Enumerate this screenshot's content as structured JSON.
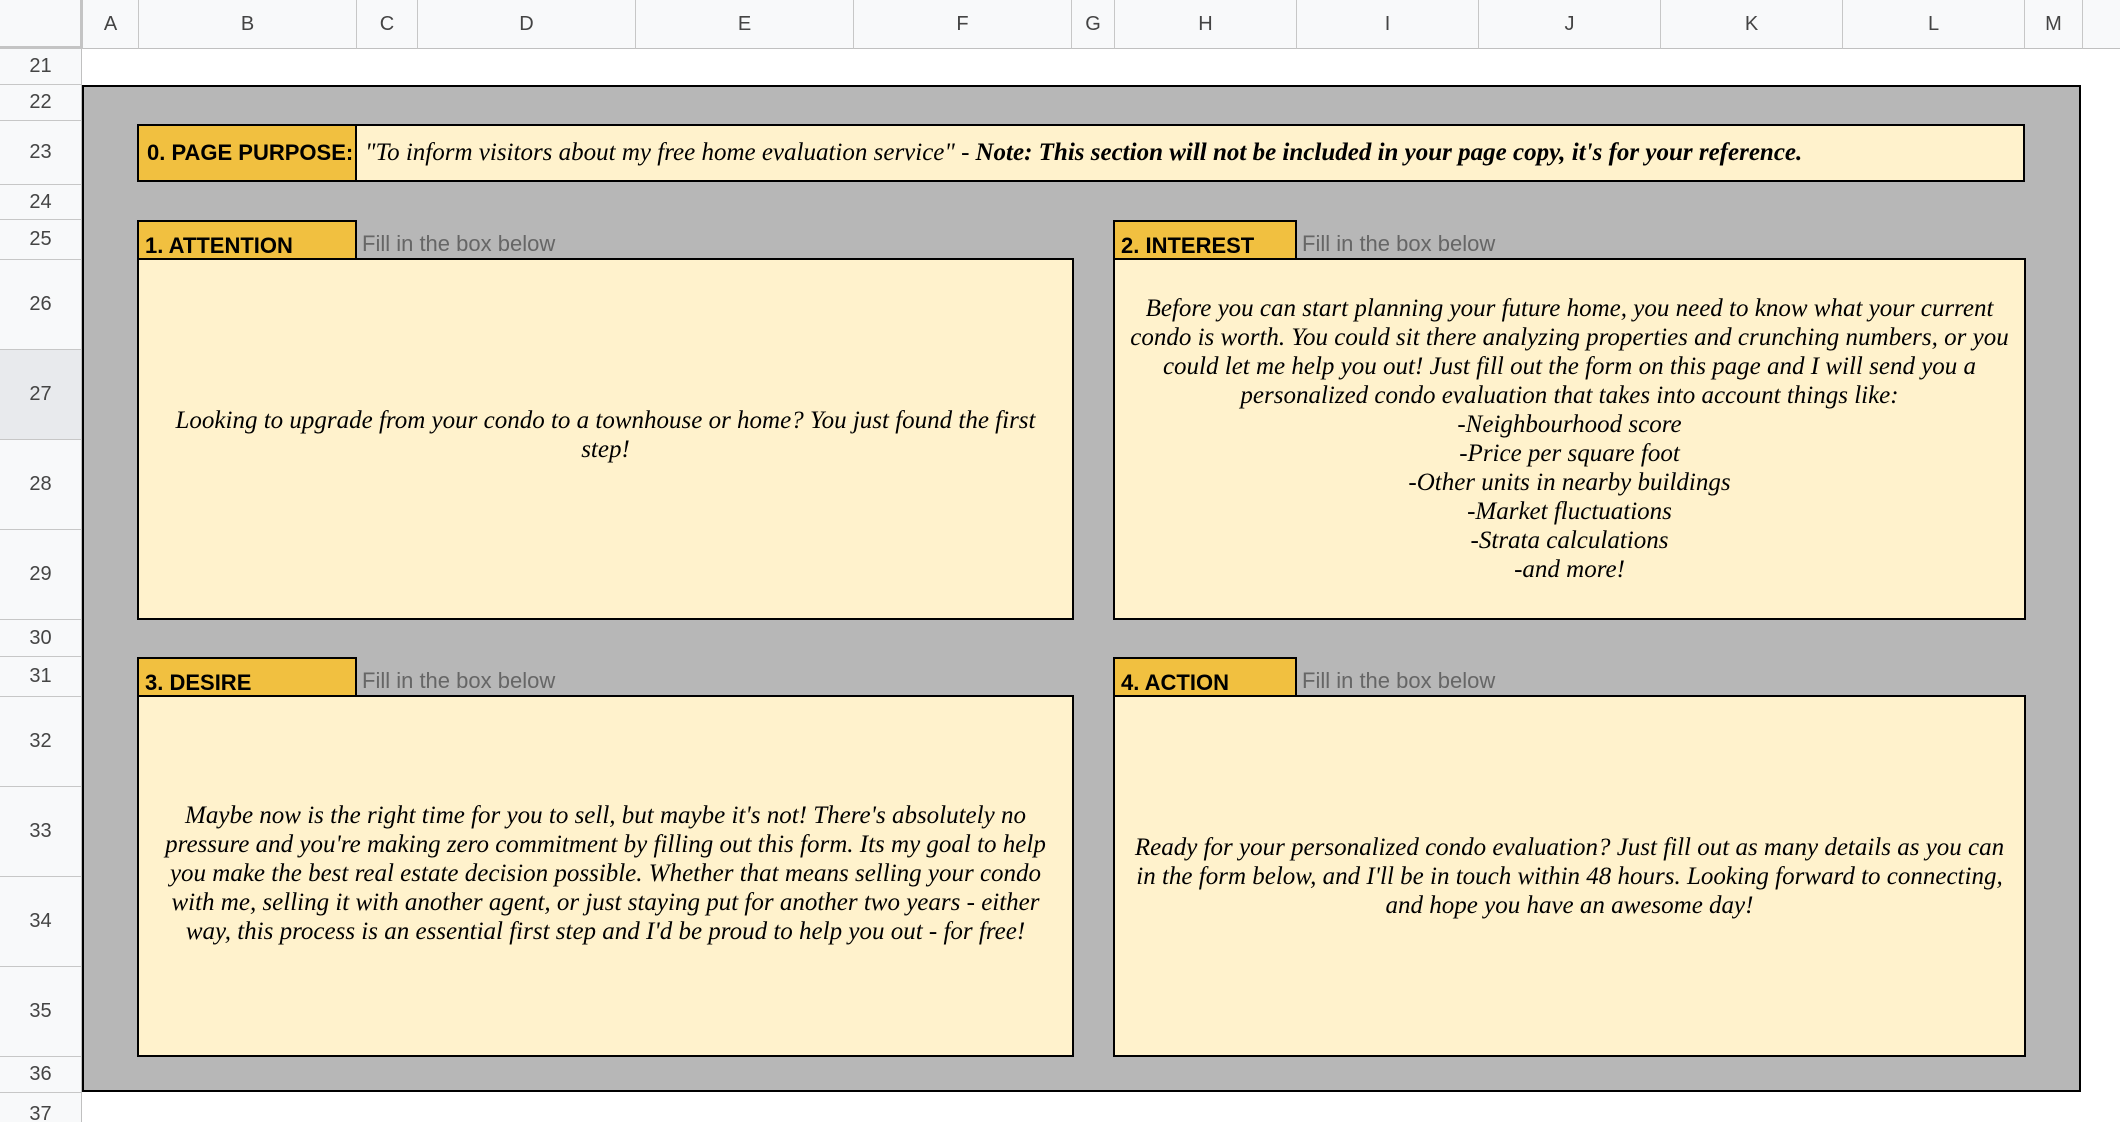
{
  "sheet": {
    "columns": [
      "A",
      "B",
      "C",
      "D",
      "E",
      "F",
      "G",
      "H",
      "I",
      "J",
      "K",
      "L",
      "M"
    ],
    "rows": [
      "21",
      "22",
      "23",
      "24",
      "25",
      "26",
      "27",
      "28",
      "29",
      "30",
      "31",
      "32",
      "33",
      "34",
      "35",
      "36",
      "37"
    ]
  },
  "purpose": {
    "label": "0. PAGE PURPOSE:",
    "text": "\"To inform visitors about my free home evaluation service\" -",
    "note": "Note: This section will not be included in your page copy, it's for your reference."
  },
  "sections": [
    {
      "label": "1. ATTENTION",
      "hint": "Fill in the box below",
      "text": "Looking to upgrade from your condo to a townhouse or home? You just found the first step!"
    },
    {
      "label": "2. INTEREST",
      "hint": "Fill in the box below",
      "text": "Before you can start planning your future home, you need to know what your current condo is worth. You could sit there analyzing properties and crunching numbers, or you could let me help you out! Just fill out the form on this page and I will send you a personalized condo evaluation that takes into account things like:\n-Neighbourhood score\n-Price per square foot\n-Other units in nearby buildings\n-Market fluctuations\n-Strata calculations\n-and more!"
    },
    {
      "label": "3. DESIRE",
      "hint": "Fill in the box below",
      "text": "Maybe now is the right time for you to sell, but maybe it's not! There's absolutely no pressure and you're making zero commitment by filling out this form. Its my goal to help you make the best real estate decision possible. Whether that means selling your condo with me, selling it with another agent, or just staying put for another two years - either way, this process is an essential first step and I'd be proud to help you out - for free!"
    },
    {
      "label": "4. ACTION",
      "hint": "Fill in the box below",
      "text": "Ready for your personalized condo evaluation? Just fill out as many details as you can in the form below, and I'll be in touch within 48 hours. Looking forward to connecting, and hope you have an awesome day!"
    }
  ]
}
